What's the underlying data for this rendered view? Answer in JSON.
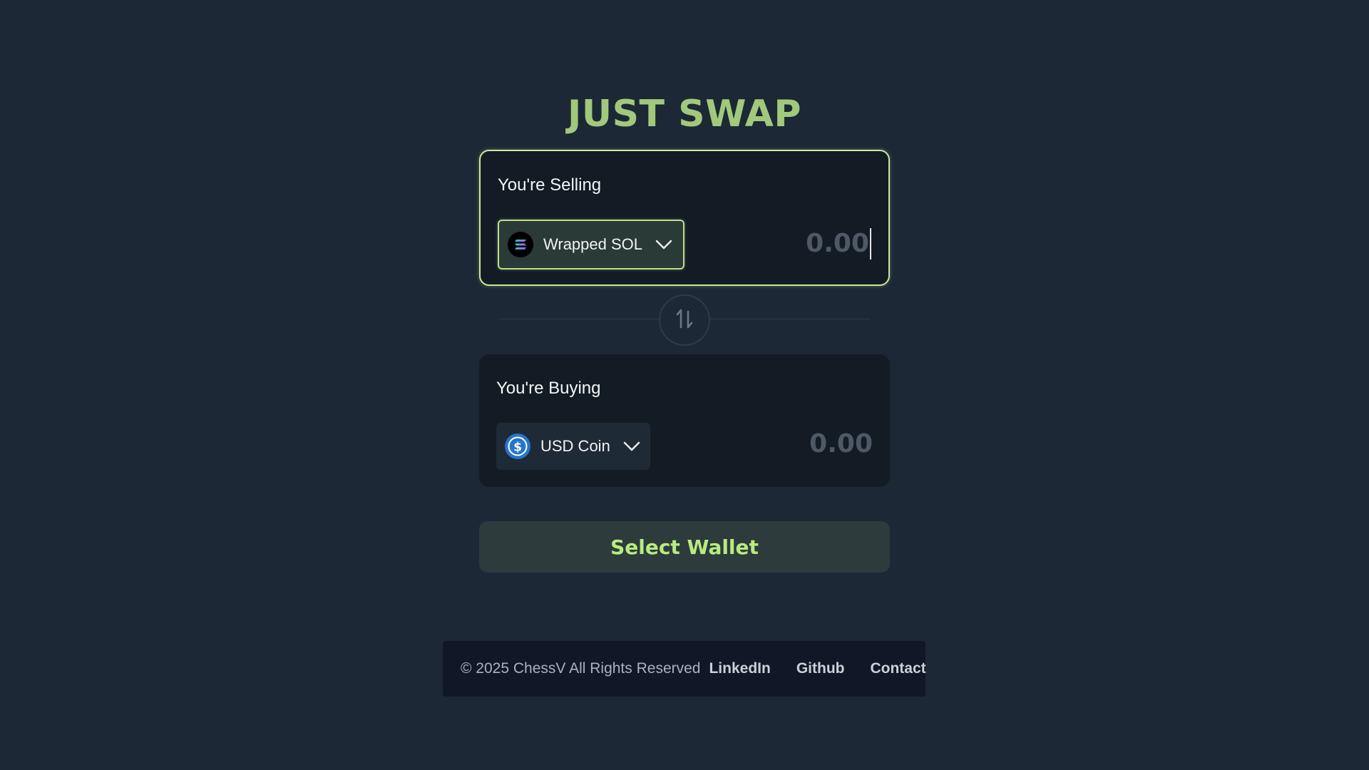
{
  "header": {
    "title": "JUST SWAP"
  },
  "selling": {
    "label": "You're Selling",
    "token": {
      "name": "Wrapped SOL",
      "icon": "solana-icon"
    },
    "amount_placeholder": "0.00"
  },
  "swap": {
    "icon": "swap-arrows-icon"
  },
  "buying": {
    "label": "You're Buying",
    "token": {
      "name": "USD Coin",
      "icon": "usdc-icon"
    },
    "amount_placeholder": "0.00"
  },
  "wallet_button": {
    "label": "Select Wallet"
  },
  "footer": {
    "copyright": "© 2025 ChessV All Rights Reserved",
    "links": [
      "LinkedIn",
      "Github",
      "Contact"
    ]
  },
  "colors": {
    "background": "#1c2836",
    "accent": "#a2c97b",
    "panel": "#131b25",
    "button_text": "#b9ea7f",
    "usdc": "#2775ca"
  }
}
